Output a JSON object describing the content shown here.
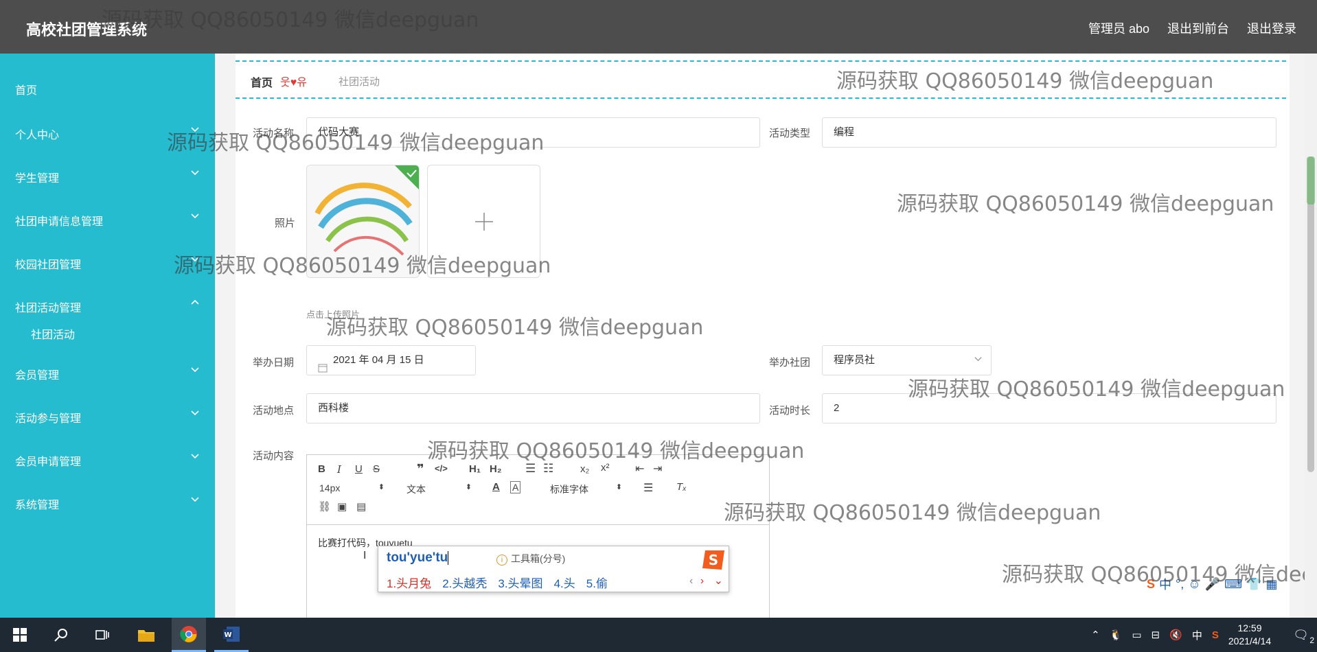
{
  "header": {
    "title": "高校社团管理系统",
    "admin_label": "管理员 abo",
    "frontend_link": "退出到前台",
    "logout_link": "退出登录"
  },
  "sidebar": {
    "items": [
      {
        "label": "首页"
      },
      {
        "label": "个人中心"
      },
      {
        "label": "学生管理"
      },
      {
        "label": "社团申请信息管理"
      },
      {
        "label": "校园社团管理"
      },
      {
        "label": "社团活动管理"
      },
      {
        "label": "社团活动"
      },
      {
        "label": "会员管理"
      },
      {
        "label": "活动参与管理"
      },
      {
        "label": "会员申请管理"
      },
      {
        "label": "系统管理"
      }
    ]
  },
  "breadcrumb": {
    "home": "首页",
    "separator": "웃♥유",
    "current": "社团活动"
  },
  "form": {
    "name_label": "活动名称",
    "name_value": "代码大赛",
    "type_label": "活动类型",
    "type_value": "编程",
    "photo_label": "照片",
    "upload_tip": "点击上传照片",
    "date_label": "举办日期",
    "date_value": "2021 年 04 月 15 日",
    "club_label": "举办社团",
    "club_value": "程序员社",
    "place_label": "活动地点",
    "place_value": "西科楼",
    "duration_label": "活动时长",
    "duration_value": "2",
    "content_label": "活动内容"
  },
  "editor": {
    "font_size": "14px",
    "block_format": "文本",
    "font_family": "标准字体",
    "content": "比赛打代码，touyuetu"
  },
  "ime": {
    "composition": "tou'yue'tu",
    "toolbox": "工具箱(分号)",
    "candidates": [
      "1.头月兔",
      "2.头越秃",
      "3.头晕图",
      "4.头",
      "5.偷"
    ]
  },
  "watermark": "源码获取 QQ86050149 微信deepguan",
  "taskbar": {
    "time": "12:59",
    "date": "2021/4/14",
    "input_lang": "中",
    "notifications": "2"
  },
  "colors": {
    "sidebar_bg": "#26bcd0",
    "header_bg": "#4d4d4d",
    "taskbar_bg": "#1f2933"
  }
}
